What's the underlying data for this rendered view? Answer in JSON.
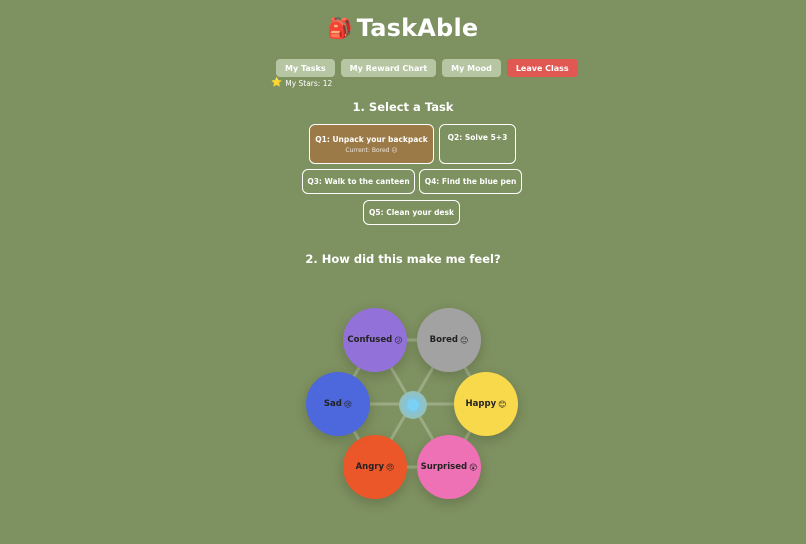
{
  "app": {
    "icon": "backpack-icon",
    "glyph": "🎒",
    "title": "TaskAble"
  },
  "nav": [
    {
      "label": "My Tasks"
    },
    {
      "label": "My Reward Chart"
    },
    {
      "label": "My Mood"
    },
    {
      "label": "Leave Class"
    }
  ],
  "stars": {
    "icon": "star-icon",
    "glyph": "⭐",
    "label": "My Stars: 12"
  },
  "section1": {
    "title": "1. Select a Task"
  },
  "tasks": [
    {
      "label": "Q1: Unpack your backpack",
      "sub": "Current: Bored 😐"
    },
    {
      "label": "Q2: Solve 5+3"
    },
    {
      "label": "Q3: Walk to the canteen"
    },
    {
      "label": "Q4: Find the blue pen"
    },
    {
      "label": "Q5: Clean your desk"
    }
  ],
  "section2": {
    "title": "2. How did this make me feel?"
  },
  "emotions": [
    {
      "label": "Confused",
      "emoji": "😕",
      "color": "#9272d8"
    },
    {
      "label": "Bored",
      "emoji": "😐",
      "color": "#a2a2a2"
    },
    {
      "label": "Happy",
      "emoji": "😊",
      "color": "#f9d94c"
    },
    {
      "label": "Surprised",
      "emoji": "😲",
      "color": "#ee70b5"
    },
    {
      "label": "Angry",
      "emoji": "😠",
      "color": "#ec5729"
    },
    {
      "label": "Sad",
      "emoji": "😢",
      "color": "#4d67dc"
    }
  ],
  "colors": {
    "background": "#7e9160",
    "nav_button": "#b6c6a3",
    "leave_button": "#e15752",
    "selected_task": "#9c7a48"
  }
}
